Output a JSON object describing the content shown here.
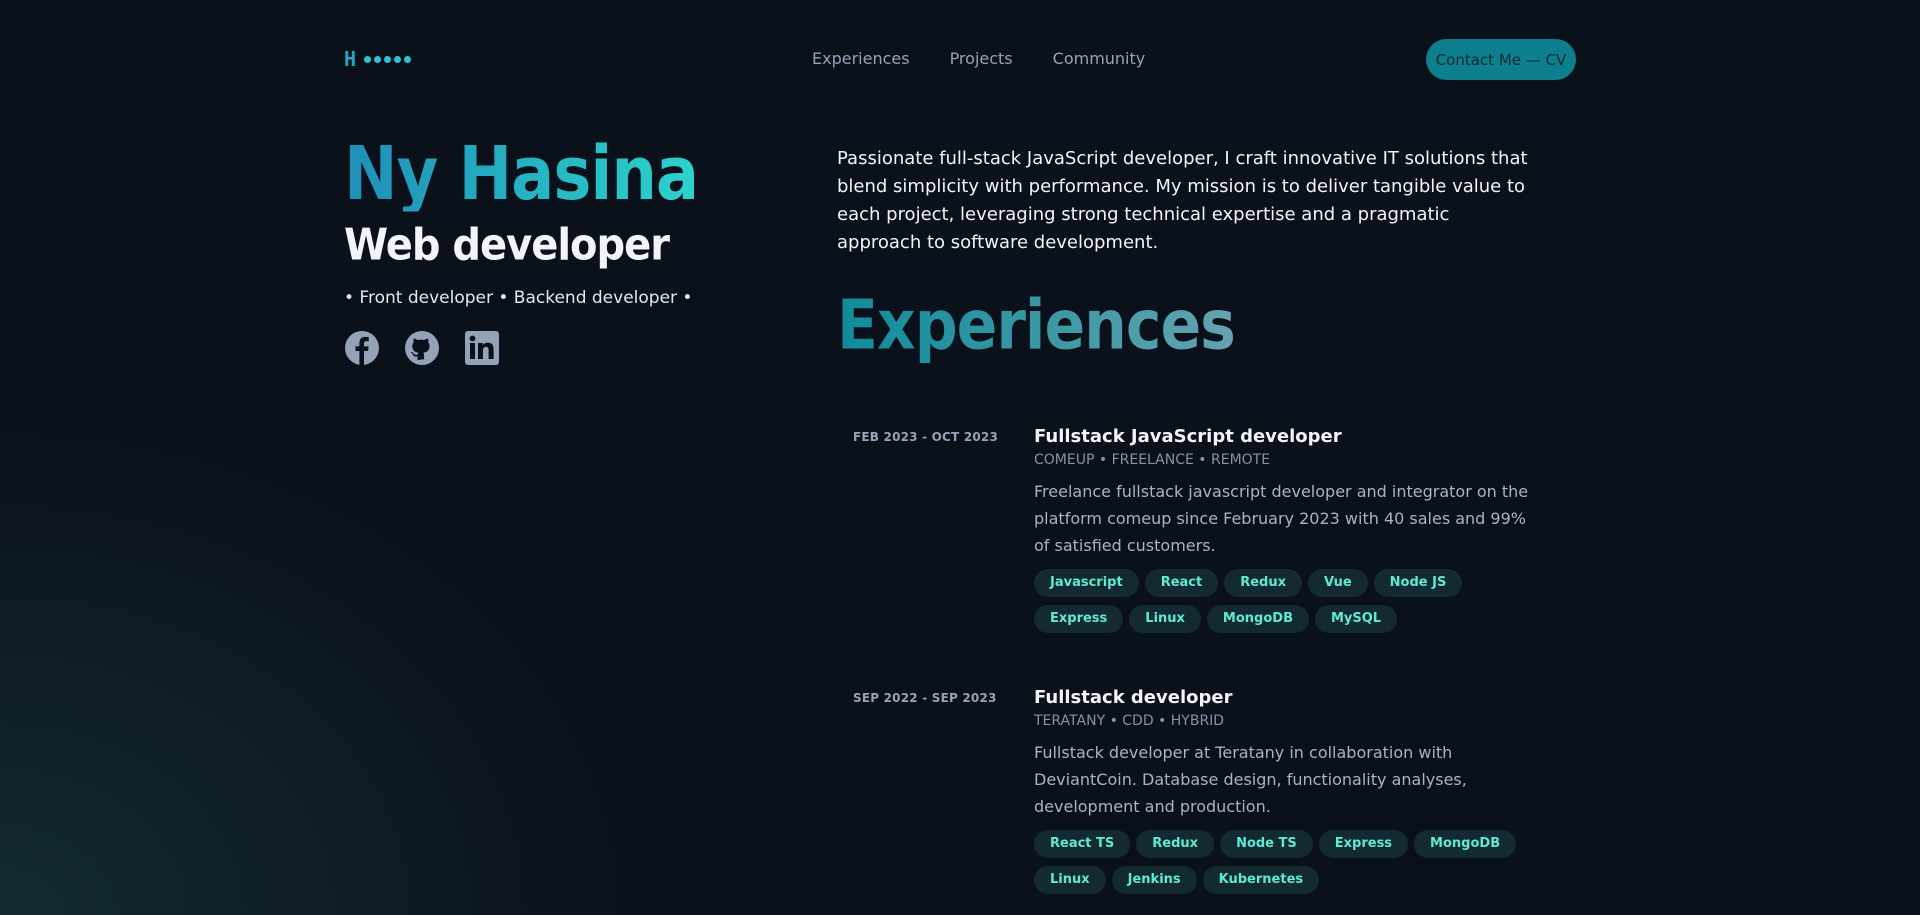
{
  "header": {
    "logo_letter": "H",
    "nav": [
      {
        "label": "Experiences"
      },
      {
        "label": "Projects"
      },
      {
        "label": "Community"
      }
    ],
    "contact_label": "Contact Me — CV"
  },
  "profile": {
    "name": "Ny Hasina",
    "role": "Web developer",
    "tagline": "• Front developer • Backend developer •",
    "socials": [
      {
        "icon": "facebook-icon"
      },
      {
        "icon": "github-icon"
      },
      {
        "icon": "linkedin-icon"
      }
    ]
  },
  "intro": "Passionate full-stack JavaScript developer, I craft innovative IT solutions that blend simplicity with performance. My mission is to deliver tangible value to each project, leveraging strong technical expertise and a pragmatic approach to software development.",
  "experiences_title": "Experiences",
  "experiences": [
    {
      "date": "FEB 2023 - OCT 2023",
      "title": "Fullstack JavaScript developer",
      "meta": "COMEUP • FREELANCE • REMOTE",
      "description": "Freelance fullstack javascript developer and integrator on the platform comeup since February 2023 with 40 sales and 99% of satisfied customers.",
      "tags": [
        "Javascript",
        "React",
        "Redux",
        "Vue",
        "Node JS",
        "Express",
        "Linux",
        "MongoDB",
        "MySQL"
      ]
    },
    {
      "date": "SEP 2022 - SEP 2023",
      "title": "Fullstack developer",
      "meta": "TERATANY • CDD • HYBRID",
      "description": "Fullstack developer at Teratany in collaboration with DeviantCoin. Database design, functionality analyses, development and production.",
      "tags": [
        "React TS",
        "Redux",
        "Node TS",
        "Express",
        "MongoDB",
        "Linux",
        "Jenkins",
        "Kubernetes"
      ]
    }
  ],
  "colors": {
    "background": "#0b111b",
    "accent": "#0e7f8f",
    "tag_text": "#5eead4",
    "tag_bg": "#122a30"
  }
}
